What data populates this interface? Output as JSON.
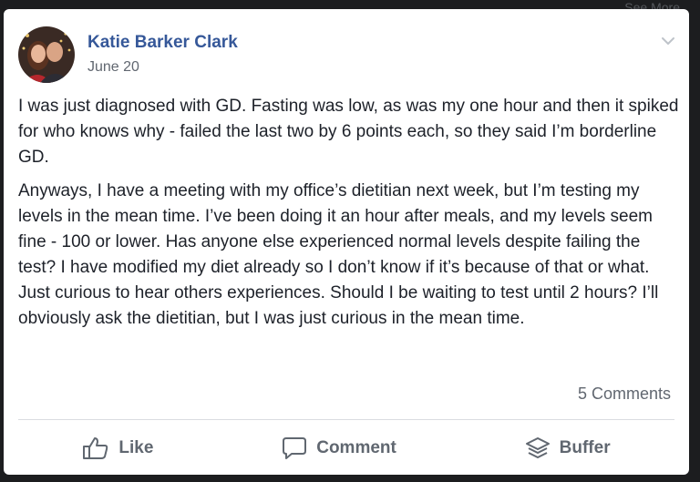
{
  "backdrop": {
    "hint_text": "See More"
  },
  "post": {
    "author": "Katie Barker Clark",
    "date": "June 20",
    "paragraphs": [
      "I was just diagnosed with GD. Fasting was low, as was my one hour and then it spiked for who knows why - failed the last two by 6 points each, so they said I’m borderline GD.",
      "Anyways, I have a meeting with my office’s dietitian next week, but I’m testing my levels in the mean time. I’ve been doing it an hour after meals, and my levels seem fine - 100 or lower. Has anyone else experienced normal levels despite failing the test? I have modified my diet already so I don’t know if it’s because of that or what. Just curious to hear others experiences. Should I be waiting to test until 2 hours? I’ll obviously ask the dietitian, but I was just curious in the mean time."
    ],
    "comments_count": "5 Comments"
  },
  "actions": {
    "like": "Like",
    "comment": "Comment",
    "buffer": "Buffer"
  },
  "icons": {
    "options": "chevron-down-icon",
    "like": "thumbs-up-icon",
    "comment": "speech-bubble-icon",
    "buffer": "layers-stack-icon"
  },
  "colors": {
    "author_link": "#365899",
    "secondary_text": "#616770",
    "body_text": "#1d2129",
    "backdrop": "#1c1d1f"
  }
}
